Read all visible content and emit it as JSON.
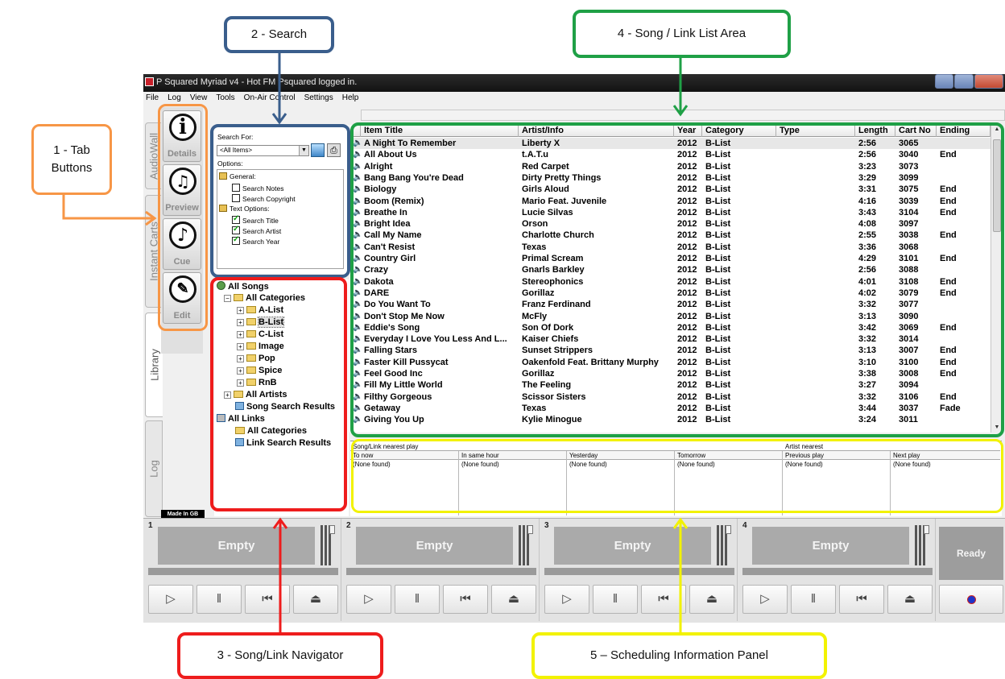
{
  "window": {
    "title": "P Squared Myriad v4 - Hot FM Psquared logged in.",
    "menu": [
      "File",
      "Log",
      "View",
      "Tools",
      "On-Air Control",
      "Settings",
      "Help"
    ]
  },
  "side_tabs": [
    "AudioWall",
    "Instant Carts",
    "Library",
    "Log"
  ],
  "tool_buttons": [
    {
      "label": "Details",
      "icon": "info-icon"
    },
    {
      "label": "Preview",
      "icon": "headphones-icon"
    },
    {
      "label": "Cue",
      "icon": "cue-icon"
    },
    {
      "label": "Edit",
      "icon": "edit-icon"
    }
  ],
  "made_in": "Made In GB",
  "search": {
    "search_for_label": "Search For:",
    "selected": "<All Items>",
    "options_label": "Options:",
    "general_label": "General:",
    "general_options": [
      {
        "label": "Search Notes",
        "checked": false
      },
      {
        "label": "Search Copyright",
        "checked": false
      }
    ],
    "text_options_label": "Text Options:",
    "text_options": [
      {
        "label": "Search Title",
        "checked": true
      },
      {
        "label": "Search Artist",
        "checked": true
      },
      {
        "label": "Search Year",
        "checked": true
      }
    ]
  },
  "navigator": {
    "all_songs": "All Songs",
    "all_categories": "All Categories",
    "categories": [
      "A-List",
      "B-List",
      "C-List",
      "Image",
      "Pop",
      "Spice",
      "RnB"
    ],
    "selected_category": "B-List",
    "all_artists": "All Artists",
    "song_search_results": "Song Search Results",
    "all_links": "All Links",
    "link_all_categories": "All Categories",
    "link_search_results": "Link Search Results"
  },
  "song_list": {
    "columns": [
      "Item Title",
      "Artist/Info",
      "Year",
      "Category",
      "Type",
      "Length",
      "Cart No",
      "Ending"
    ],
    "rows": [
      [
        "A Night To Remember",
        "Liberty X",
        "2012",
        "B-List",
        "",
        "2:56",
        "3065",
        ""
      ],
      [
        "All About Us",
        "t.A.T.u",
        "2012",
        "B-List",
        "",
        "2:56",
        "3040",
        "End"
      ],
      [
        "Alright",
        "Red Carpet",
        "2012",
        "B-List",
        "",
        "3:23",
        "3073",
        ""
      ],
      [
        "Bang Bang You're Dead",
        "Dirty Pretty Things",
        "2012",
        "B-List",
        "",
        "3:29",
        "3099",
        ""
      ],
      [
        "Biology",
        "Girls Aloud",
        "2012",
        "B-List",
        "",
        "3:31",
        "3075",
        "End"
      ],
      [
        "Boom (Remix)",
        "Mario Feat. Juvenile",
        "2012",
        "B-List",
        "",
        "4:16",
        "3039",
        "End"
      ],
      [
        "Breathe In",
        "Lucie Silvas",
        "2012",
        "B-List",
        "",
        "3:43",
        "3104",
        "End"
      ],
      [
        "Bright Idea",
        "Orson",
        "2012",
        "B-List",
        "",
        "4:08",
        "3097",
        ""
      ],
      [
        "Call My Name",
        "Charlotte Church",
        "2012",
        "B-List",
        "",
        "2:55",
        "3038",
        "End"
      ],
      [
        "Can't Resist",
        "Texas",
        "2012",
        "B-List",
        "",
        "3:36",
        "3068",
        ""
      ],
      [
        "Country Girl",
        "Primal Scream",
        "2012",
        "B-List",
        "",
        "4:29",
        "3101",
        "End"
      ],
      [
        "Crazy",
        "Gnarls Barkley",
        "2012",
        "B-List",
        "",
        "2:56",
        "3088",
        ""
      ],
      [
        "Dakota",
        "Stereophonics",
        "2012",
        "B-List",
        "",
        "4:01",
        "3108",
        "End"
      ],
      [
        "DARE",
        "Gorillaz",
        "2012",
        "B-List",
        "",
        "4:02",
        "3079",
        "End"
      ],
      [
        "Do You Want To",
        "Franz Ferdinand",
        "2012",
        "B-List",
        "",
        "3:32",
        "3077",
        ""
      ],
      [
        "Don't Stop Me Now",
        "McFly",
        "2012",
        "B-List",
        "",
        "3:13",
        "3090",
        ""
      ],
      [
        "Eddie's Song",
        "Son Of Dork",
        "2012",
        "B-List",
        "",
        "3:42",
        "3069",
        "End"
      ],
      [
        "Everyday I Love You Less And L...",
        "Kaiser Chiefs",
        "2012",
        "B-List",
        "",
        "3:32",
        "3014",
        ""
      ],
      [
        "Falling Stars",
        "Sunset Strippers",
        "2012",
        "B-List",
        "",
        "3:13",
        "3007",
        "End"
      ],
      [
        "Faster Kill Pussycat",
        "Oakenfold Feat. Brittany Murphy",
        "2012",
        "B-List",
        "",
        "3:10",
        "3100",
        "End"
      ],
      [
        "Feel Good Inc",
        "Gorillaz",
        "2012",
        "B-List",
        "",
        "3:38",
        "3008",
        "End"
      ],
      [
        "Fill My Little World",
        "The Feeling",
        "2012",
        "B-List",
        "",
        "3:27",
        "3094",
        ""
      ],
      [
        "Filthy Gorgeous",
        "Scissor Sisters",
        "2012",
        "B-List",
        "",
        "3:32",
        "3106",
        "End"
      ],
      [
        "Getaway",
        "Texas",
        "2012",
        "B-List",
        "",
        "3:44",
        "3037",
        "Fade"
      ],
      [
        "Giving You Up",
        "Kylie Minogue",
        "2012",
        "B-List",
        "",
        "3:24",
        "3011",
        ""
      ]
    ]
  },
  "scheduling": {
    "group_song": "Song/Link nearest play",
    "group_artist": "Artist nearest",
    "columns": [
      "To now",
      "In same hour",
      "Yesterday",
      "Tomorrow",
      "Previous play",
      "Next play"
    ],
    "value": "(None found)"
  },
  "players": [
    {
      "number": "1",
      "label": "Empty"
    },
    {
      "number": "2",
      "label": "Empty"
    },
    {
      "number": "3",
      "label": "Empty"
    },
    {
      "number": "4",
      "label": "Empty"
    }
  ],
  "ready_label": "Ready",
  "annotations": {
    "tab_buttons": "1 - Tab Buttons",
    "search": "2 - Search",
    "navigator": "3 - Song/Link Navigator",
    "song_list": "4 - Song / Link List Area",
    "scheduling": "5 – Scheduling Information Panel"
  },
  "colors": {
    "orange": "#f79646",
    "blue": "#3a5e8c",
    "red": "#ee1c1c",
    "green": "#1fa046",
    "yellow": "#f2f200"
  }
}
